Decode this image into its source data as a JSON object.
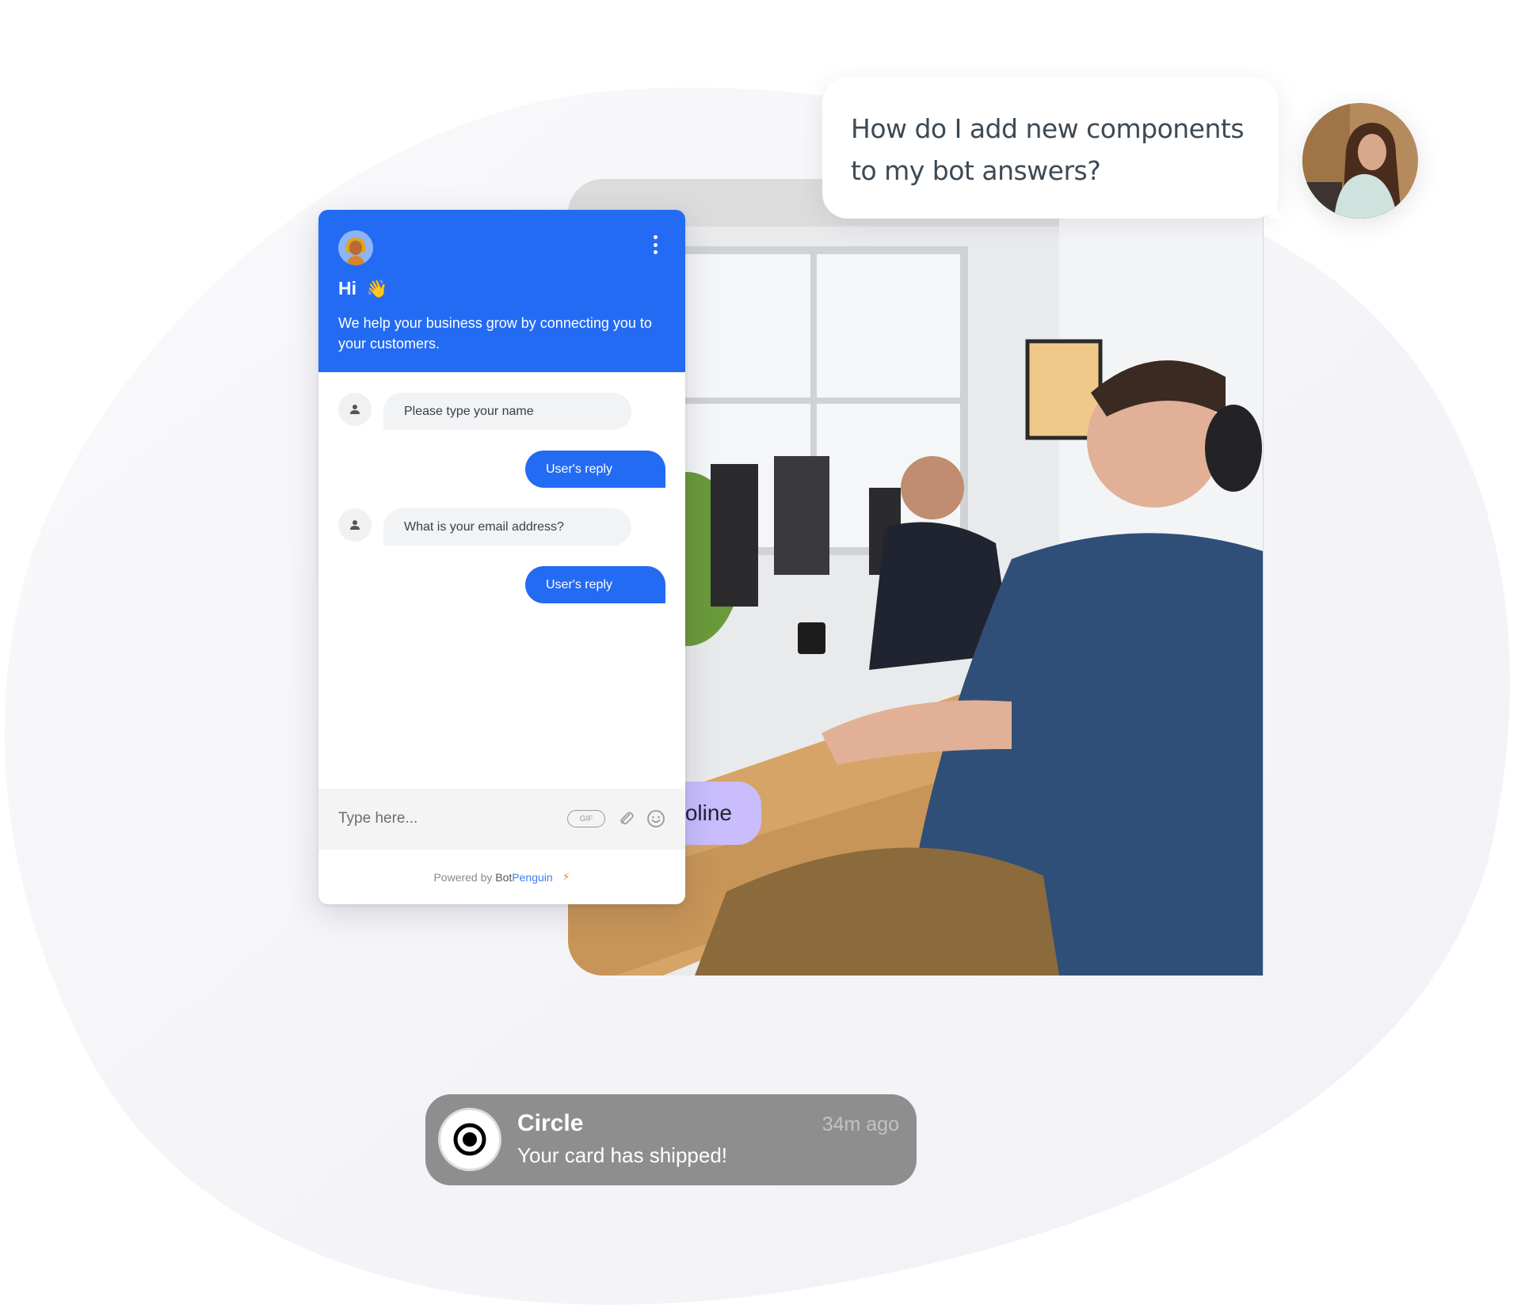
{
  "colors": {
    "brand_blue": "#236bf3",
    "blob": "#f3f3f7",
    "pill_purple": "#c9bdfd",
    "notification_gray": "#8e8e8e",
    "question_text": "#3d4a55",
    "powered_by_accent": "#3f7cf0",
    "bolt_orange": "#f58a1f"
  },
  "question_bubble": {
    "text": "How do I add new components to my bot answers?",
    "avatar_icon": "woman-avatar-photo"
  },
  "photo": {
    "icon": "office-team-photo"
  },
  "pill": {
    "text": "oline"
  },
  "widget": {
    "header": {
      "avatar_icon": "bot-avatar",
      "menu_icon": "kebab-menu-icon",
      "greeting": "Hi",
      "wave_emoji": "👋",
      "tagline": "We help your business grow by connecting you to your customers."
    },
    "messages": [
      {
        "from": "bot",
        "text": "Please type your name"
      },
      {
        "from": "user",
        "text": "User's reply"
      },
      {
        "from": "bot",
        "text": "What is your email address?"
      },
      {
        "from": "user",
        "text": "User's reply"
      }
    ],
    "input": {
      "placeholder": "Type here...",
      "value": "",
      "gif_label": "GIF",
      "attach_icon": "paperclip-icon",
      "emoji_icon": "smiley-icon"
    },
    "footer": {
      "prefix": "Powered by ",
      "brand_part1": "Bot",
      "brand_part2": "Penguin",
      "bolt": "⚡"
    }
  },
  "notification": {
    "app": "Circle",
    "message": "Your card has shipped!",
    "time": "34m ago",
    "icon": "circle-target-icon"
  }
}
